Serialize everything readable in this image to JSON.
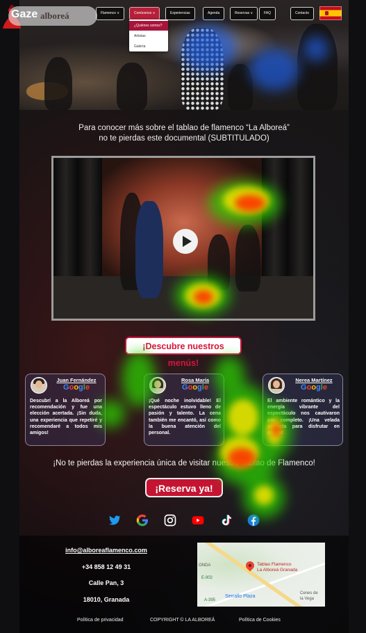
{
  "overlay": {
    "brand": "Gaze",
    "logo_text": "alboreá"
  },
  "nav": {
    "items": [
      {
        "label": "Flamenco",
        "caret": "∨"
      },
      {
        "label": "Conócenos",
        "caret": "∨"
      },
      {
        "label": "Experiencias",
        "caret": ""
      },
      {
        "label": "Agenda",
        "caret": ""
      },
      {
        "label": "Reservas",
        "caret": "∨"
      },
      {
        "label": "FAQ",
        "caret": ""
      },
      {
        "label": "Contacto",
        "caret": ""
      }
    ],
    "dropdown": [
      "¿Quiénes somos?",
      "Artistas",
      "Galería"
    ],
    "flag_icon": "spain-flag-icon"
  },
  "intro": {
    "line1": "Para conocer más sobre el tablao de flamenco “La Alboreá”",
    "line2": "no te pierdas este documental (SUBTITULADO)"
  },
  "video": {
    "play_icon": "play-icon"
  },
  "menus_cta": "¡Descubre nuestros menús!",
  "reviews": [
    {
      "name": "Juan Fernández",
      "source": "Google",
      "text": "Descubrí a la Alboreá por recomendación y fue una elección acertada. ¡Sin duda, una experiencia que repetiré y recomendaré a todos mis amigos!"
    },
    {
      "name": "Rosa María",
      "source": "Google",
      "text": "¡Qué noche inolvidable! El espectáculo estuvo lleno de pasión y talento. La cena también me encantó, así como la buena atención del personal."
    },
    {
      "name": "Nerea Martínez",
      "source": "Google",
      "text": "El ambiente romántico y la energía vibrante del espectáculo nos cautivaron por completo. ¡Una velada perfecta para disfrutar en pareja!"
    }
  ],
  "tagline": "¡No te pierdas la experiencia única de visitar nuestro Tablao de Flamenco!",
  "reserve_cta": "¡Reserva ya!",
  "socials": [
    "twitter-icon",
    "google-icon",
    "instagram-icon",
    "youtube-icon",
    "tiktok-icon",
    "facebook-icon"
  ],
  "contact": {
    "email": "info@alboreaflamenco.com",
    "phone": "+34 858 12 49 31",
    "street": "Calle Pan, 3",
    "city": "18010, Granada"
  },
  "map": {
    "place_line1": "Tablao Flamenco",
    "place_line2": "La Alboreá Granada",
    "label_left": "ONDA",
    "road": "E-902",
    "road2": "A-395",
    "plaza": "Serrallo Plaza",
    "town_line1": "Cenes de",
    "town_line2": "la Vega"
  },
  "footer": {
    "privacy": "Política de privacidad",
    "copyright": "COPYRIGHT © LA ALBOREÁ",
    "cookies": "Política de Cookies"
  },
  "colors": {
    "accent": "#c41432",
    "cta_text": "#d4163c"
  }
}
